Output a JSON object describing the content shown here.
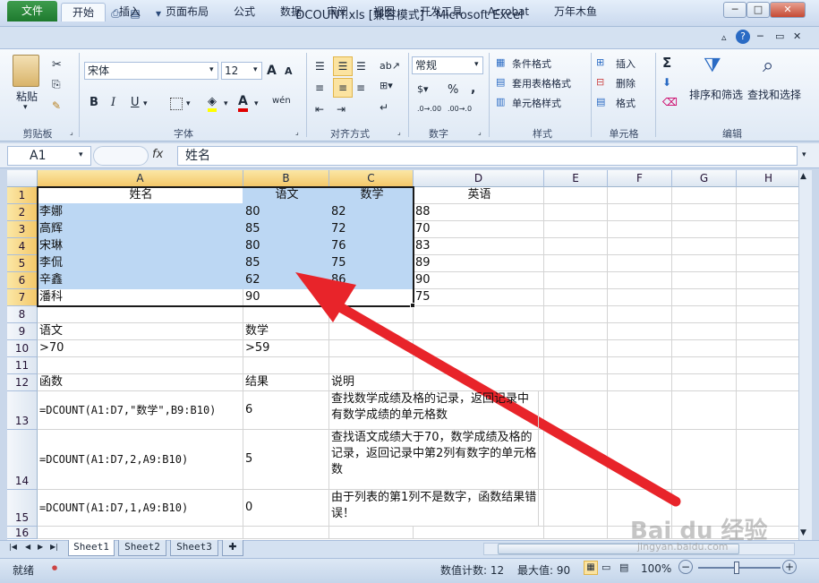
{
  "titlebar": {
    "title": "DCOUNT.xls  [兼容模式]  -  Microsoft Excel"
  },
  "tabs": [
    "文件",
    "开始",
    "插入",
    "页面布局",
    "公式",
    "数据",
    "审阅",
    "视图",
    "开发工具",
    "Acrobat",
    "万年木鱼"
  ],
  "ribbon": {
    "clipboard": {
      "paste": "粘贴",
      "label": "剪贴板"
    },
    "font": {
      "name": "宋体",
      "size": "12",
      "bold": "B",
      "italic": "I",
      "underline": "U",
      "label": "字体",
      "grow": "A",
      "shrink": "A",
      "phonetic": "wén",
      "color_a": "A"
    },
    "align": {
      "label": "对齐方式"
    },
    "number": {
      "format": "常规",
      "label": "数字",
      "pct": "%",
      "comma": ",",
      "inc": ".0→.00",
      "dec": ".00→.0"
    },
    "styles": {
      "cond": "条件格式",
      "table": "套用表格格式",
      "cell": "单元格样式",
      "label": "样式"
    },
    "cells": {
      "insert": "插入",
      "delete": "删除",
      "format": "格式",
      "label": "单元格"
    },
    "editing": {
      "sum": "Σ",
      "sort": "排序和筛选",
      "find": "查找和选择",
      "label": "编辑"
    }
  },
  "formula_bar": {
    "name_box": "A1",
    "fx": "fx",
    "content": "姓名"
  },
  "columns": [
    "A",
    "B",
    "C",
    "D",
    "E",
    "F",
    "G",
    "H"
  ],
  "rows": [
    {
      "n": "1",
      "cells": [
        "姓名",
        "语文",
        "数学",
        "英语"
      ]
    },
    {
      "n": "2",
      "cells": [
        "李娜",
        "80",
        "82",
        "88"
      ]
    },
    {
      "n": "3",
      "cells": [
        "高辉",
        "85",
        "72",
        "70"
      ]
    },
    {
      "n": "4",
      "cells": [
        "宋琳",
        "80",
        "76",
        "83"
      ]
    },
    {
      "n": "5",
      "cells": [
        "李侃",
        "85",
        "75",
        "89"
      ]
    },
    {
      "n": "6",
      "cells": [
        "辛鑫",
        "62",
        "86",
        "90"
      ]
    },
    {
      "n": "7",
      "cells": [
        "潘科",
        "90",
        "",
        "75"
      ]
    },
    {
      "n": "8",
      "cells": [
        "",
        "",
        "",
        ""
      ]
    },
    {
      "n": "9",
      "cells": [
        "语文",
        "数学",
        "",
        ""
      ]
    },
    {
      "n": "10",
      "cells": [
        ">70",
        ">59",
        "",
        ""
      ]
    },
    {
      "n": "11",
      "cells": [
        "",
        "",
        "",
        ""
      ]
    },
    {
      "n": "12",
      "cells": [
        "函数",
        "结果",
        "说明",
        ""
      ]
    },
    {
      "n": "13",
      "cells": [
        "=DCOUNT(A1:D7,\"数学\",B9:B10)",
        "6",
        "查找数学成绩及格的记录，返回记录中有数学成绩的单元格数",
        ""
      ]
    },
    {
      "n": "14",
      "cells": [
        "=DCOUNT(A1:D7,2,A9:B10)",
        "5",
        "查找语文成绩大于70，数学成绩及格的记录，返回记录中第2列有数字的单元格数",
        ""
      ]
    },
    {
      "n": "15",
      "cells": [
        "=DCOUNT(A1:D7,1,A9:B10)",
        "0",
        "由于列表的第1列不是数字，函数结果错误！",
        ""
      ]
    },
    {
      "n": "16",
      "cells": [
        "",
        "",
        "",
        ""
      ]
    }
  ],
  "sheets": [
    "Sheet1",
    "Sheet2",
    "Sheet3"
  ],
  "status": {
    "ready": "就绪",
    "count": "数值计数: 12",
    "max": "最大值: 90",
    "zoom": "100%"
  },
  "watermark": {
    "text": "Bai du 经验",
    "url": "jingyan.baidu.com"
  },
  "colors": {
    "accent": "#1e7a2e",
    "selection": "#bcd7f3",
    "arrow": "#e8242a"
  }
}
